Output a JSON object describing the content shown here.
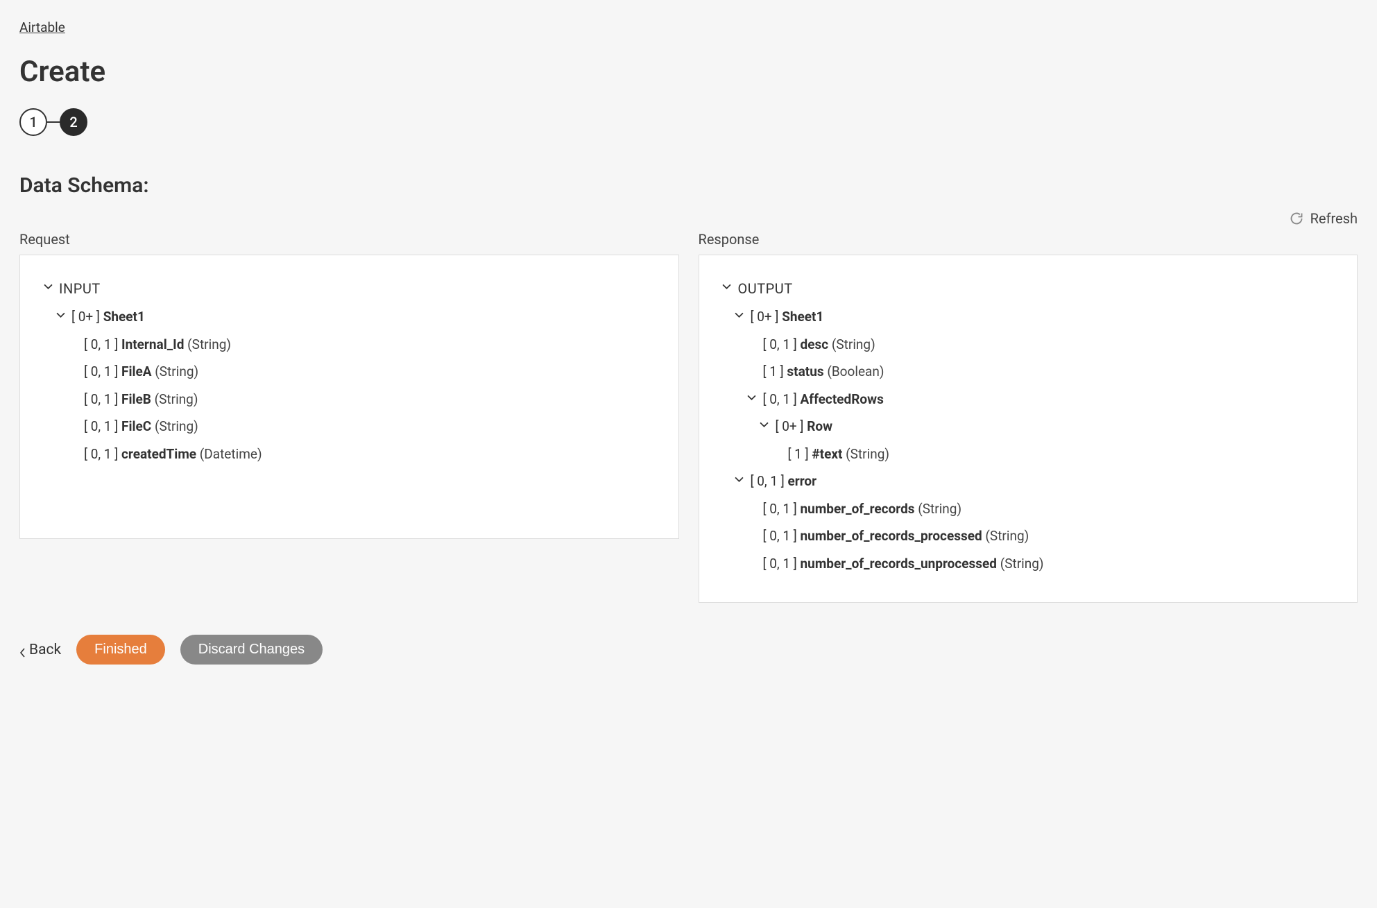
{
  "breadcrumb": "Airtable",
  "pageTitle": "Create",
  "steps": {
    "one": "1",
    "two": "2"
  },
  "sectionTitle": "Data Schema:",
  "refreshLabel": "Refresh",
  "request": {
    "label": "Request",
    "root": "INPUT",
    "sheet": {
      "card": "[ 0+ ]",
      "name": "Sheet1"
    },
    "fields": [
      {
        "card": "[ 0, 1 ]",
        "name": "Internal_Id",
        "type": "(String)"
      },
      {
        "card": "[ 0, 1 ]",
        "name": "FileA",
        "type": "(String)"
      },
      {
        "card": "[ 0, 1 ]",
        "name": "FileB",
        "type": "(String)"
      },
      {
        "card": "[ 0, 1 ]",
        "name": "FileC",
        "type": "(String)"
      },
      {
        "card": "[ 0, 1 ]",
        "name": "createdTime",
        "type": "(Datetime)"
      }
    ]
  },
  "response": {
    "label": "Response",
    "root": "OUTPUT",
    "sheet": {
      "card": "[ 0+ ]",
      "name": "Sheet1"
    },
    "sheetFields": [
      {
        "card": "[ 0, 1 ]",
        "name": "desc",
        "type": "(String)"
      },
      {
        "card": "[ 1 ]",
        "name": "status",
        "type": "(Boolean)"
      }
    ],
    "affected": {
      "card": "[ 0, 1 ]",
      "name": "AffectedRows"
    },
    "row": {
      "card": "[ 0+ ]",
      "name": "Row"
    },
    "rowFields": [
      {
        "card": "[ 1 ]",
        "name": "#text",
        "type": "(String)"
      }
    ],
    "error": {
      "card": "[ 0, 1 ]",
      "name": "error"
    },
    "errorFields": [
      {
        "card": "[ 0, 1 ]",
        "name": "number_of_records",
        "type": "(String)"
      },
      {
        "card": "[ 0, 1 ]",
        "name": "number_of_records_processed",
        "type": "(String)"
      },
      {
        "card": "[ 0, 1 ]",
        "name": "number_of_records_unprocessed",
        "type": "(String)"
      }
    ]
  },
  "actions": {
    "back": "Back",
    "finished": "Finished",
    "discard": "Discard Changes"
  }
}
